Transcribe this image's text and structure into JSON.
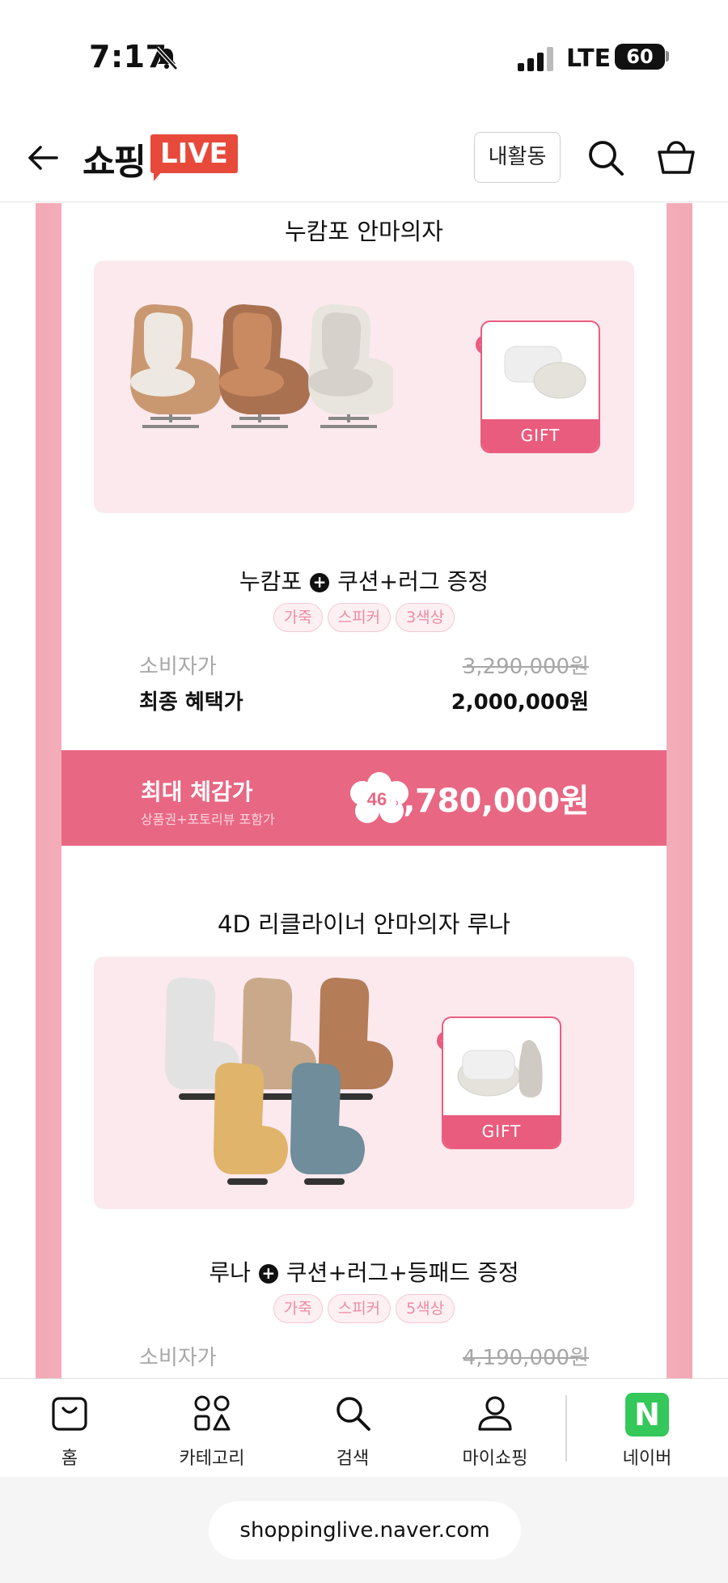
{
  "status_bar": {
    "time": "7:17",
    "network": "LTE",
    "battery": "60"
  },
  "header": {
    "logo_text": "쇼핑",
    "logo_live": "LIVE",
    "activity_button": "내활동"
  },
  "products": [
    {
      "title": "누캄포 안마의자",
      "offer_name": "누캄포",
      "offer_plus": "+",
      "offer_gift": "쿠션+러그 증정",
      "gift_label": "GIFT",
      "tags": [
        "가죽",
        "스피커",
        "3색상"
      ],
      "consumer_price_label": "소비자가",
      "consumer_price": "3,290,000원",
      "final_price_label": "최종 혜택가",
      "final_price": "2,000,000원",
      "benefit_title": "최대 체감가",
      "benefit_sub": "상품권+포토리뷰 포함가",
      "discount": "46",
      "discount_unit": "%",
      "benefit_price": "1,780,000원",
      "chair_colors": [
        "#c99871",
        "#a9714f",
        "#e8e4de"
      ]
    },
    {
      "title": "4D 리클라이너 안마의자 루나",
      "offer_name": "루나",
      "offer_plus": "+",
      "offer_gift": "쿠션+러그+등패드 증정",
      "gift_label": "GIFT",
      "tags": [
        "가죽",
        "스피커",
        "5색상"
      ],
      "consumer_price_label": "소비자가",
      "consumer_price": "4,190,000원",
      "chair_colors": [
        "#e2e2e2",
        "#c9a989",
        "#b47c57",
        "#e0b46a",
        "#6f8d9a"
      ]
    }
  ],
  "tab_bar": {
    "tabs": [
      {
        "label": "홈",
        "icon": "home-bag-icon"
      },
      {
        "label": "카테고리",
        "icon": "category-icon"
      },
      {
        "label": "검색",
        "icon": "search-icon"
      },
      {
        "label": "마이쇼핑",
        "icon": "person-icon"
      },
      {
        "label": "네이버",
        "icon": "naver-n-icon"
      }
    ],
    "naver_letter": "N"
  },
  "browser": {
    "url": "shoppinglive.naver.com"
  },
  "colors": {
    "accent_pink": "#e86783",
    "gift_pink": "#ea5c7e",
    "logo_red": "#e74a3b",
    "naver_green": "#34c759"
  }
}
